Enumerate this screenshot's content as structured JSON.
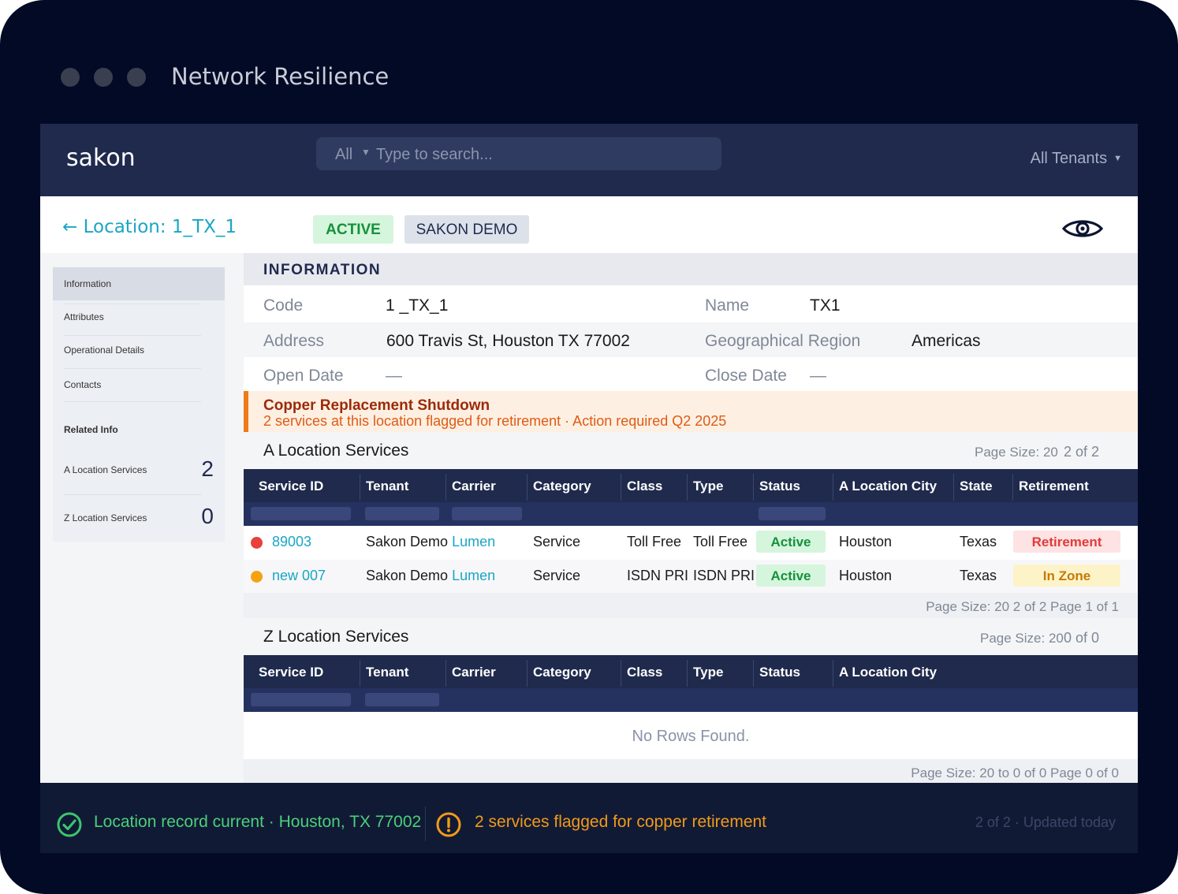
{
  "window": {
    "title": "Network Resilience"
  },
  "header": {
    "brand": "sakon",
    "search_scope": "All",
    "search_placeholder": "Type to search...",
    "tenant_select": "All Tenants"
  },
  "location": {
    "title": "← Location:  1_TX_1",
    "status_badge": "ACTIVE",
    "tenant_badge": "SAKON DEMO"
  },
  "sidebar": {
    "items": [
      "Information",
      "Attributes",
      "Operational Details",
      "Contacts"
    ],
    "related_heading": "Related Info",
    "related": [
      {
        "label": "A Location Services",
        "count": "2"
      },
      {
        "label": "Z Location Services",
        "count": "0"
      }
    ]
  },
  "information": {
    "heading": "INFORMATION",
    "code_label": "Code",
    "code_value": "1 _TX_1",
    "name_label": "Name",
    "name_value": "TX1",
    "address_label": "Address",
    "address_value": "600 Travis St, Houston TX 77002",
    "region_label": "Geographical Region",
    "region_value": "Americas",
    "open_label": "Open Date",
    "open_value": "—",
    "close_label": "Close Date",
    "close_value": "—"
  },
  "alert": {
    "title": "Copper Replacement Shutdown",
    "message": "2 services at this location flagged for retirement · Action required Q2 2025"
  },
  "a_services": {
    "title": "A Location Services",
    "page_size": "Page Size: 20",
    "count": "2 of 2",
    "columns": [
      "Service ID",
      "Tenant",
      "Carrier",
      "Category",
      "Class",
      "Type",
      "Status",
      "A Location City",
      "State",
      "Retirement"
    ],
    "rows": [
      {
        "dot_color": "#e8403a",
        "service_id": "89003",
        "tenant": "Sakon Demo",
        "carrier": "Lumen",
        "category": "Service",
        "class": "Toll Free",
        "type": "Toll Free",
        "status": "Active",
        "city": "Houston",
        "state": "Texas",
        "retirement": "Retirement",
        "retirement_bg": "#fde3e3",
        "retirement_color": "#e23a3a"
      },
      {
        "dot_color": "#f5a20f",
        "service_id": "new 007",
        "tenant": "Sakon Demo",
        "carrier": "Lumen",
        "category": "Service",
        "class": "ISDN PRI",
        "type": "ISDN PRI",
        "status": "Active",
        "city": "Houston",
        "state": "Texas",
        "retirement": "In Zone",
        "retirement_bg": "#fdf3c8",
        "retirement_color": "#c47a06"
      }
    ],
    "footer": "Page Size: 20 2 of 2 Page 1 of 1"
  },
  "z_services": {
    "title": "Z Location Services",
    "page_size": "Page Size: 20",
    "count": "0 of 0",
    "columns": [
      "Service ID",
      "Tenant",
      "Carrier",
      "Category",
      "Class",
      "Type",
      "Status",
      "A Location City"
    ],
    "empty_text": "No Rows Found.",
    "footer": "Page Size: 20 to 0 of 0 Page 0 of 0"
  },
  "status_bar": {
    "ok_text": "Location record current · Houston, TX 77002",
    "warn_text": "2 services flagged for copper retirement",
    "meta": "2 of 2 · Updated today"
  },
  "colors": {
    "navy": "#1f2a4d",
    "accent": "#1aa6c4",
    "success": "#15913a",
    "warning": "#ef7a17"
  }
}
